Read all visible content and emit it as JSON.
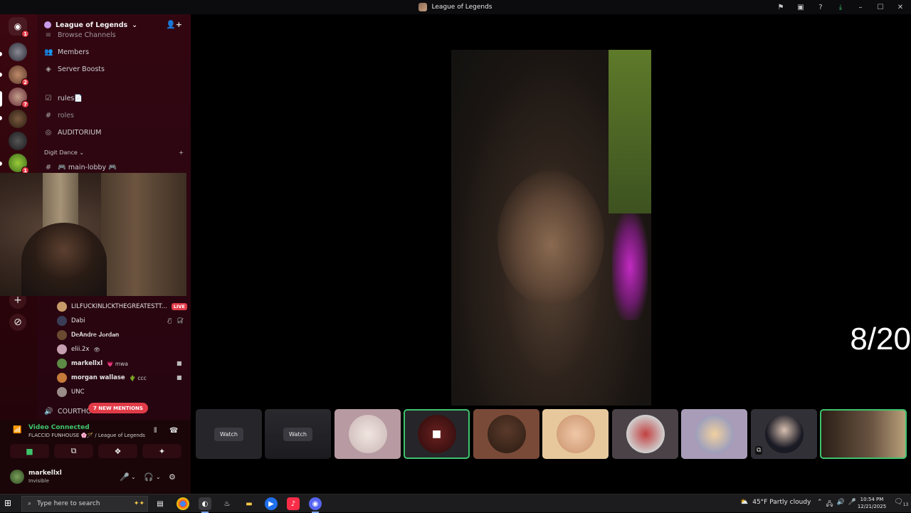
{
  "window": {
    "title": "League of Legends",
    "controls": {
      "minimize": "–",
      "maximize": "☐",
      "close": "✕"
    }
  },
  "rail": {
    "servers": [
      {
        "name": "discord-home",
        "badge": "1"
      },
      {
        "name": "server-2",
        "badge": ""
      },
      {
        "name": "server-3",
        "badge": "2"
      },
      {
        "name": "server-4",
        "badge": "7"
      },
      {
        "name": "server-5",
        "badge": ""
      },
      {
        "name": "server-6",
        "badge": ""
      },
      {
        "name": "server-7",
        "badge": "1"
      }
    ],
    "add_server": "+",
    "discover": "⊘"
  },
  "sidebar": {
    "guild_name": "League of Legends",
    "channels": [
      {
        "label": "Browse Channels"
      },
      {
        "label": "Members"
      },
      {
        "label": "Server Boosts"
      },
      {
        "label": "rules📄"
      },
      {
        "label": "roles"
      },
      {
        "label": "AUDITORIUM"
      }
    ],
    "category": "Digit Dance",
    "category_chevron": "⌄",
    "category_add": "+",
    "main_lobby": "🎮 main-lobby 🎮",
    "voice_members": [
      {
        "name": "LILFUCKINLICKTHEGREATESTT...",
        "extra": "",
        "live": "LIVE",
        "color": "#c89a6a"
      },
      {
        "name": "Dabi",
        "extra": "",
        "live": "",
        "color": "#3a3d55"
      },
      {
        "name": "𝐃𝐞𝐀𝐧𝐝𝐫𝐞 𝐉𝐨𝐫𝐝𝐚𝐧",
        "extra": "",
        "live": "",
        "color": "#6a4a30"
      },
      {
        "name": "elii.2x",
        "extra": "👁",
        "live": "",
        "color": "#c6a0b0"
      },
      {
        "name": "markellxl",
        "extra": "💗 mwa",
        "live": "",
        "color": "#5d8a45"
      },
      {
        "name": "morgan wallase",
        "extra": "🌵 ccc",
        "live": "",
        "color": "#c57a3a"
      },
      {
        "name": "UNC",
        "extra": "",
        "live": "",
        "color": "#9a8c88"
      }
    ],
    "courthouse": "COURTHOUSE",
    "new_mentions": "7 NEW MENTIONS"
  },
  "voice_panel": {
    "status": "Video Connected",
    "location": "FLACCID FUNHOUSE 🌸🪄 / League of Legends"
  },
  "user": {
    "name": "markellxl",
    "status": "Invisible"
  },
  "stage": {
    "counter": "8/20",
    "tiles": [
      {
        "kind": "watch",
        "label": "Watch"
      },
      {
        "kind": "watch",
        "label": "Watch"
      },
      {
        "kind": "avatar",
        "label": "",
        "color": "#c0a0a8"
      },
      {
        "kind": "camera",
        "label": "",
        "color": "#3a1010"
      },
      {
        "kind": "avatar",
        "label": "",
        "color": "#7a4a38"
      },
      {
        "kind": "avatar",
        "label": "",
        "color": "#e7c89c"
      },
      {
        "kind": "avatar",
        "label": "",
        "color": "#4a4246"
      },
      {
        "kind": "avatar",
        "label": "",
        "color": "#a89cb8"
      },
      {
        "kind": "avatar",
        "label": "",
        "color": "#303036"
      },
      {
        "kind": "video",
        "label": "",
        "color": "#3a2a1f"
      }
    ]
  },
  "taskbar": {
    "search_placeholder": "Type here to search",
    "weather": "45°F  Partly cloudy",
    "time": "10:54 PM",
    "date": "12/21/2025",
    "notification_count": "13"
  },
  "colors": {
    "accent_green": "#3ec46d",
    "badge_red": "#e23b48",
    "sidebar_bg": "#320611"
  }
}
